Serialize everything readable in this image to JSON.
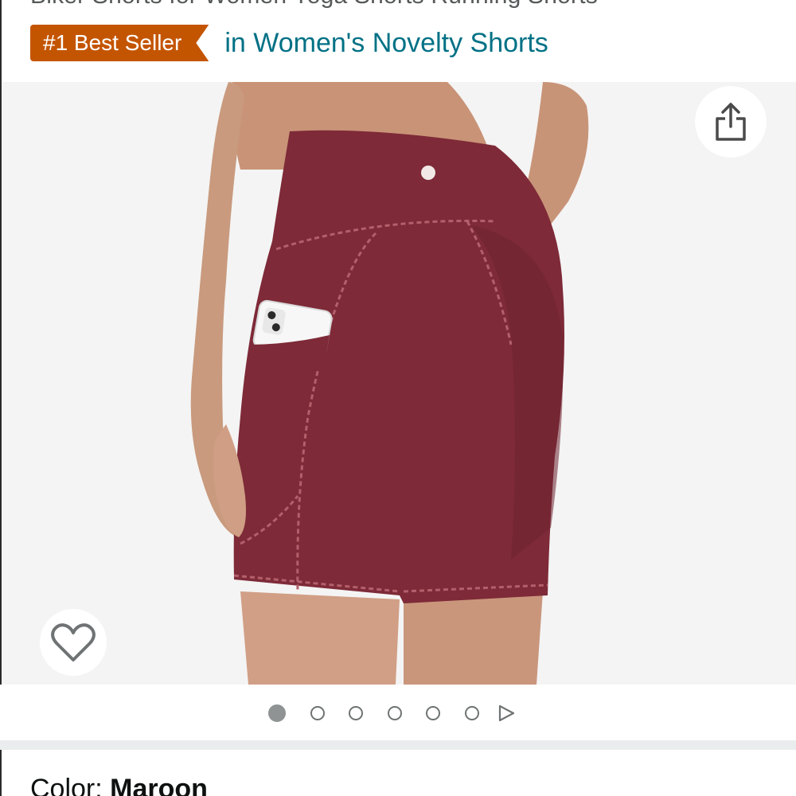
{
  "product": {
    "title": "Biker Shorts for Women Yoga Shorts Running Shorts",
    "badge": "#1 Best Seller",
    "category_link": "in Women's Novelty Shorts"
  },
  "image": {
    "alt": "Maroon high-waisted biker shorts with side pocket holding a phone",
    "product_color": "#7e2a38"
  },
  "actions": {
    "share_icon": "share-icon",
    "wishlist_icon": "heart-icon"
  },
  "carousel": {
    "image_count": 6,
    "active_index": 0,
    "next_icon": "play-arrow-icon"
  },
  "color": {
    "label": "Color: ",
    "value": "Maroon"
  },
  "colors": {
    "badge_bg": "#c45500",
    "link": "#007185",
    "image_bg": "#f4f4f4"
  }
}
